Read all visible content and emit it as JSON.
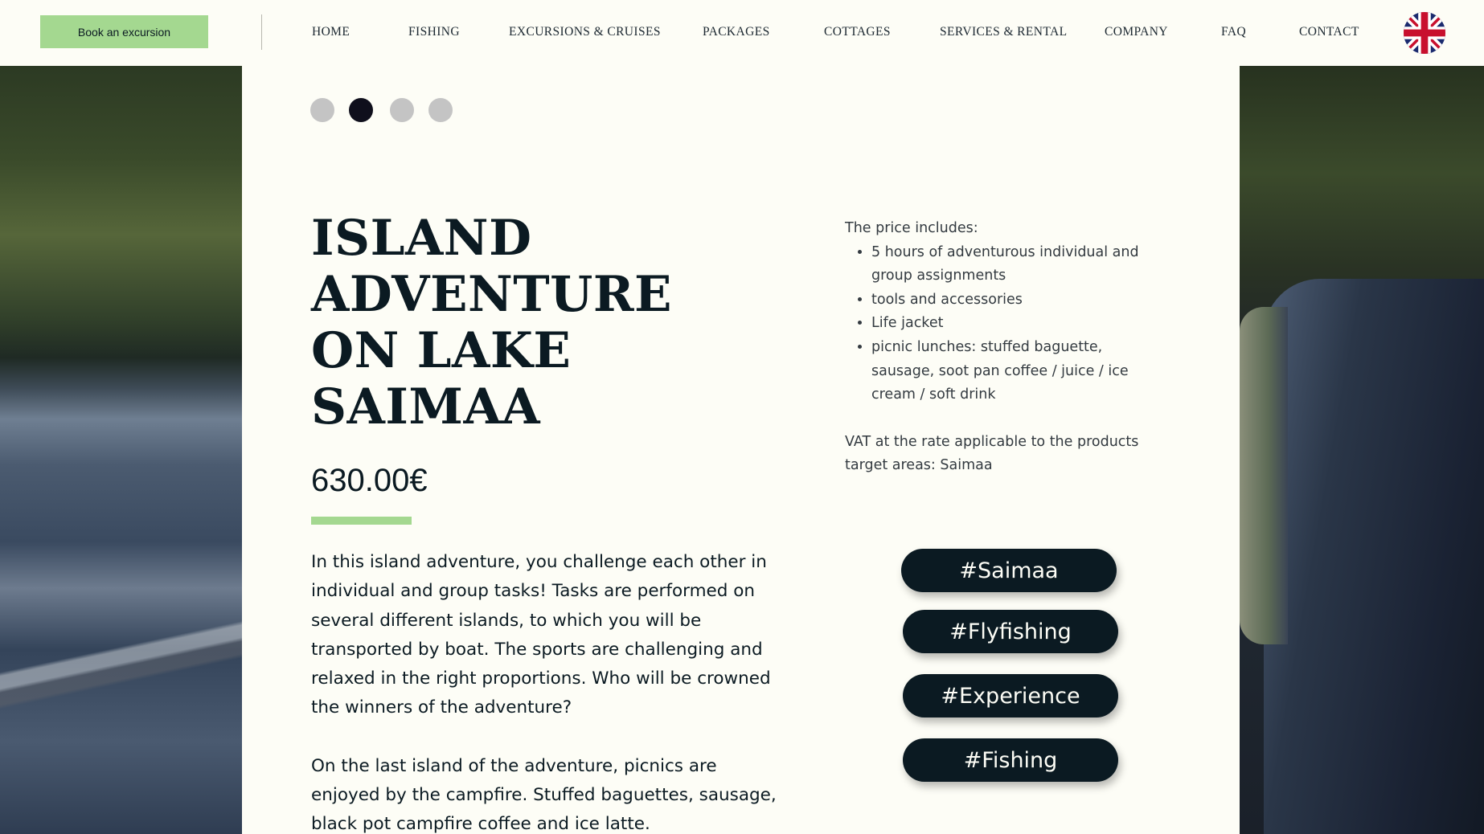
{
  "header": {
    "book_label": "Book an excursion",
    "nav": [
      "HOME",
      "FISHING",
      "EXCURSIONS & CRUISES",
      "PACKAGES",
      "COTTAGES",
      "SERVICES & RENTAL",
      "COMPANY",
      "FAQ",
      "CONTACT"
    ],
    "language_flag": "uk-flag-icon"
  },
  "slider": {
    "dots": 4,
    "active_index": 1
  },
  "product": {
    "title": "ISLAND ADVENTURE ON LAKE SAIMAA",
    "price": "630.00€",
    "description": [
      "In this island adventure, you challenge each other in individual and group tasks! Tasks are performed on several different islands, to which you will be transported by boat. The sports are challenging and relaxed in the right proportions. Who will be crowned the winners of the adventure?",
      "On the last island of the adventure, picnics are enjoyed by the campfire. Stuffed baguettes, sausage, black pot campfire coffee and ice latte."
    ]
  },
  "includes": {
    "heading": "The price includes:",
    "items": [
      "5 hours of adventurous individual and group assignments",
      "tools and accessories",
      "Life jacket",
      "picnic lunches: stuffed baguette, sausage, soot pan coffee / juice / ice cream / soft drink"
    ],
    "vat_note": "VAT at the rate applicable to the products",
    "target_areas": "target areas: Saimaa"
  },
  "tags": [
    "#Saimaa",
    "#Flyfishing",
    "#Experience",
    "#Fishing"
  ],
  "colors": {
    "accent_green": "#a4d890",
    "dark_navy": "#0b1a22",
    "page_bg": "#fdfdf6"
  }
}
